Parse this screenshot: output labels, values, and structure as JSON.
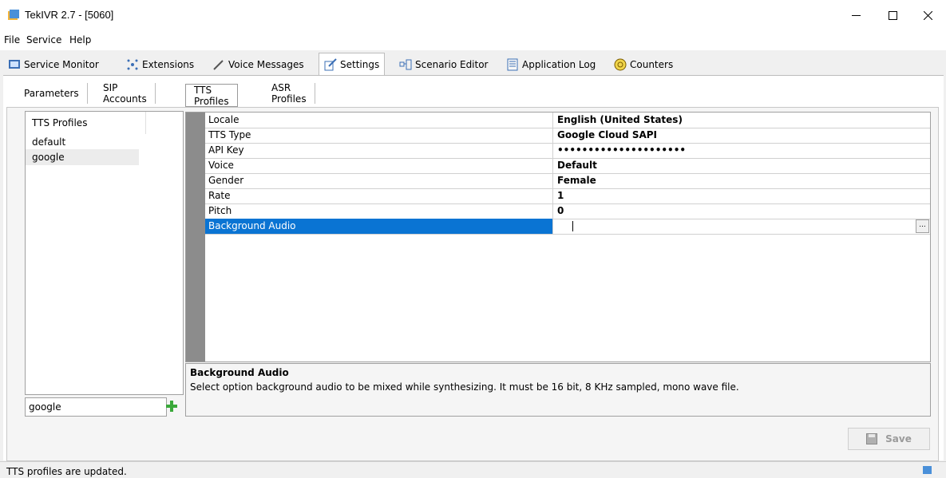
{
  "window": {
    "title": "TekIVR 2.7 - [5060]"
  },
  "menu": [
    "File",
    "Service",
    "Help"
  ],
  "main_tabs": [
    {
      "label": "Service Monitor",
      "icon": "monitor-icon"
    },
    {
      "label": "Extensions",
      "icon": "extensions-icon"
    },
    {
      "label": "Voice Messages",
      "icon": "pen-icon"
    },
    {
      "label": "Settings",
      "icon": "settings-edit-icon"
    },
    {
      "label": "Scenario Editor",
      "icon": "scenario-icon"
    },
    {
      "label": "Application Log",
      "icon": "log-icon"
    },
    {
      "label": "Counters",
      "icon": "counters-icon"
    }
  ],
  "active_main_tab": "Settings",
  "sub_tabs": [
    "Parameters",
    "SIP Accounts",
    "TTS Profiles",
    "ASR Profiles"
  ],
  "active_sub_tab": "TTS Profiles",
  "tts_list": {
    "header": "TTS Profiles",
    "items": [
      "default",
      "google"
    ],
    "selected": "google",
    "name_input_value": "google"
  },
  "properties": [
    {
      "name": "Locale",
      "value": "English (United States)"
    },
    {
      "name": "TTS Type",
      "value": "Google Cloud SAPI"
    },
    {
      "name": "API Key",
      "value": "•••••••••••••••••••••"
    },
    {
      "name": "Voice",
      "value": "Default"
    },
    {
      "name": "Gender",
      "value": "Female"
    },
    {
      "name": "Rate",
      "value": "1"
    },
    {
      "name": "Pitch",
      "value": "0"
    },
    {
      "name": "Background Audio",
      "value": ""
    }
  ],
  "selected_property": "Background Audio",
  "ellipsis_label": "...",
  "description": {
    "title": "Background Audio",
    "text": "Select option background audio to be mixed while synthesizing. It must be 16 bit, 8 KHz sampled, mono wave file."
  },
  "save_label": "Save",
  "status": "TTS profiles are updated.",
  "colors": {
    "selection": "#0a74d3",
    "grid_left": "#8c8c8c",
    "add_icon": "#3aa83a"
  }
}
